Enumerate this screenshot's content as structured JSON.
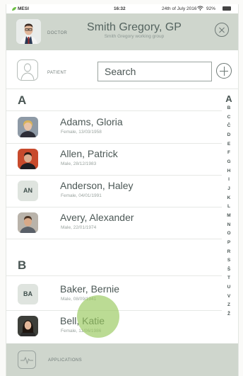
{
  "status_bar": {
    "carrier": "MESI",
    "time": "16:32",
    "date": "24th of July 2016",
    "battery": "92%"
  },
  "doctor": {
    "role_label": "DOCTOR",
    "name": "Smith Gregory, GP",
    "group": "Smith Gregory working group"
  },
  "patient": {
    "role_label": "PATIENT",
    "search_placeholder": "Search"
  },
  "sections": [
    {
      "letter": "A",
      "patients": [
        {
          "name": "Adams, Gloria",
          "details": "Female, 13/03/1958",
          "avatar": "photo",
          "initials": ""
        },
        {
          "name": "Allen, Patrick",
          "details": "Male, 28/12/1983",
          "avatar": "photo",
          "initials": ""
        },
        {
          "name": "Anderson, Haley",
          "details": "Female, 04/01/1991",
          "avatar": "initials",
          "initials": "AN"
        },
        {
          "name": "Avery, Alexander",
          "details": "Male, 22/01/1974",
          "avatar": "photo",
          "initials": ""
        }
      ]
    },
    {
      "letter": "B",
      "patients": [
        {
          "name": "Baker, Bernie",
          "details": "Male, 08/09/1941",
          "avatar": "initials",
          "initials": "BA"
        },
        {
          "name": "Bell, Katie",
          "details": "Female, 11/06/1986",
          "avatar": "photo",
          "initials": ""
        }
      ]
    }
  ],
  "alphabet_index": [
    "A",
    "B",
    "C",
    "Č",
    "D",
    "E",
    "F",
    "G",
    "H",
    "I",
    "J",
    "K",
    "L",
    "M",
    "N",
    "O",
    "P",
    "R",
    "S",
    "Š",
    "T",
    "U",
    "V",
    "Z",
    "Ž"
  ],
  "bottom_bar": {
    "label": "APPLICATIONS"
  },
  "colors": {
    "header_bg": "#cfd6cd",
    "touch_indicator": "#96c85a",
    "text": "#4a5654"
  }
}
